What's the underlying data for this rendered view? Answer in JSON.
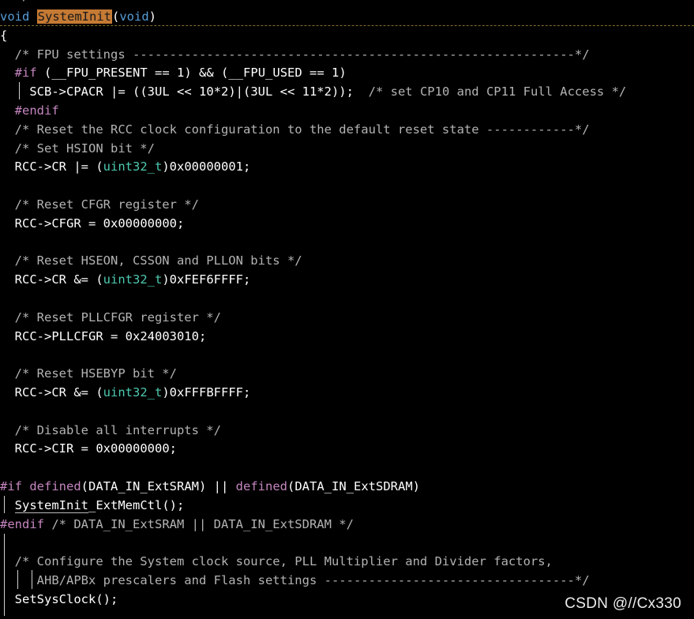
{
  "editor": {
    "top_fragment": "  */",
    "lines": [
      {
        "id": "l1",
        "parts": [
          [
            "kw",
            "void"
          ],
          [
            "sp",
            " "
          ],
          [
            "hl",
            "SystemInit"
          ],
          [
            "op",
            "("
          ],
          [
            "kw",
            "void"
          ],
          [
            "op",
            ")"
          ]
        ]
      },
      {
        "id": "l2",
        "parts": [
          [
            "op",
            "{"
          ]
        ]
      },
      {
        "id": "l3",
        "parts": [
          [
            "sp",
            "  "
          ],
          [
            "cm",
            "/* FPU settings ------------------------------------------------------------*/"
          ]
        ]
      },
      {
        "id": "l4",
        "parts": [
          [
            "sp",
            "  "
          ],
          [
            "pp",
            "#if"
          ],
          [
            "sp",
            " "
          ],
          [
            "op",
            "("
          ],
          [
            "mac",
            "__FPU_PRESENT"
          ],
          [
            "op",
            " == "
          ],
          [
            "num",
            "1"
          ],
          [
            "op",
            ")"
          ],
          [
            "op",
            " && "
          ],
          [
            "op",
            "("
          ],
          [
            "mac",
            "__FPU_USED"
          ],
          [
            "op",
            " == "
          ],
          [
            "num",
            "1"
          ],
          [
            "op",
            ")"
          ]
        ]
      },
      {
        "id": "l5",
        "parts": [
          [
            "sp",
            "    "
          ],
          [
            "id",
            "SCB->CPACR"
          ],
          [
            "op",
            " |= "
          ],
          [
            "op",
            "(("
          ],
          [
            "num",
            "3UL"
          ],
          [
            "op",
            " << "
          ],
          [
            "num",
            "10*2"
          ],
          [
            "op",
            ")|("
          ],
          [
            "num",
            "3UL"
          ],
          [
            "op",
            " << "
          ],
          [
            "num",
            "11*2"
          ],
          [
            "op",
            "));"
          ],
          [
            "sp",
            "  "
          ],
          [
            "cm",
            "/* set CP10 and CP11 Full Access */"
          ]
        ]
      },
      {
        "id": "l6",
        "parts": [
          [
            "sp",
            "  "
          ],
          [
            "pp",
            "#endif"
          ]
        ]
      },
      {
        "id": "l7",
        "parts": [
          [
            "sp",
            "  "
          ],
          [
            "cm",
            "/* Reset the RCC clock configuration to the default reset state ------------*/"
          ]
        ]
      },
      {
        "id": "l8",
        "parts": [
          [
            "sp",
            "  "
          ],
          [
            "cm",
            "/* Set HSION bit */"
          ]
        ]
      },
      {
        "id": "l9",
        "parts": [
          [
            "sp",
            "  "
          ],
          [
            "id",
            "RCC->CR"
          ],
          [
            "op",
            " |= "
          ],
          [
            "op",
            "("
          ],
          [
            "ty",
            "uint32_t"
          ],
          [
            "op",
            ")"
          ],
          [
            "num",
            "0x00000001"
          ],
          [
            "op",
            ";"
          ]
        ]
      },
      {
        "id": "l10",
        "parts": []
      },
      {
        "id": "l11",
        "parts": [
          [
            "sp",
            "  "
          ],
          [
            "cm",
            "/* Reset CFGR register */"
          ]
        ]
      },
      {
        "id": "l12",
        "parts": [
          [
            "sp",
            "  "
          ],
          [
            "id",
            "RCC->CFGR"
          ],
          [
            "op",
            " = "
          ],
          [
            "num",
            "0x00000000"
          ],
          [
            "op",
            ";"
          ]
        ]
      },
      {
        "id": "l13",
        "parts": []
      },
      {
        "id": "l14",
        "parts": [
          [
            "sp",
            "  "
          ],
          [
            "cm",
            "/* Reset HSEON, CSSON and PLLON bits */"
          ]
        ]
      },
      {
        "id": "l15",
        "parts": [
          [
            "sp",
            "  "
          ],
          [
            "id",
            "RCC->CR"
          ],
          [
            "op",
            " &= "
          ],
          [
            "op",
            "("
          ],
          [
            "ty",
            "uint32_t"
          ],
          [
            "op",
            ")"
          ],
          [
            "num",
            "0xFEF6FFFF"
          ],
          [
            "op",
            ";"
          ]
        ]
      },
      {
        "id": "l16",
        "parts": []
      },
      {
        "id": "l17",
        "parts": [
          [
            "sp",
            "  "
          ],
          [
            "cm",
            "/* Reset PLLCFGR register */"
          ]
        ]
      },
      {
        "id": "l18",
        "parts": [
          [
            "sp",
            "  "
          ],
          [
            "id",
            "RCC->PLLCFGR"
          ],
          [
            "op",
            " = "
          ],
          [
            "num",
            "0x24003010"
          ],
          [
            "op",
            ";"
          ]
        ]
      },
      {
        "id": "l19",
        "parts": []
      },
      {
        "id": "l20",
        "parts": [
          [
            "sp",
            "  "
          ],
          [
            "cm",
            "/* Reset HSEBYP bit */"
          ]
        ]
      },
      {
        "id": "l21",
        "parts": [
          [
            "sp",
            "  "
          ],
          [
            "id",
            "RCC->CR"
          ],
          [
            "op",
            " &= "
          ],
          [
            "op",
            "("
          ],
          [
            "ty",
            "uint32_t"
          ],
          [
            "op",
            ")"
          ],
          [
            "num",
            "0xFFFBFFFF"
          ],
          [
            "op",
            ";"
          ]
        ]
      },
      {
        "id": "l22",
        "parts": []
      },
      {
        "id": "l23",
        "parts": [
          [
            "sp",
            "  "
          ],
          [
            "cm",
            "/* Disable all interrupts */"
          ]
        ]
      },
      {
        "id": "l24",
        "parts": [
          [
            "sp",
            "  "
          ],
          [
            "id",
            "RCC->CIR"
          ],
          [
            "op",
            " = "
          ],
          [
            "num",
            "0x00000000"
          ],
          [
            "op",
            ";"
          ]
        ]
      },
      {
        "id": "l25",
        "parts": []
      },
      {
        "id": "l26",
        "parts": [
          [
            "pp",
            "#if"
          ],
          [
            "sp",
            " "
          ],
          [
            "pp",
            "defined"
          ],
          [
            "op",
            "("
          ],
          [
            "mac",
            "DATA_IN_ExtSRAM"
          ],
          [
            "op",
            ")"
          ],
          [
            "op",
            " || "
          ],
          [
            "pp",
            "defined"
          ],
          [
            "op",
            "("
          ],
          [
            "mac",
            "DATA_IN_ExtSDRAM"
          ],
          [
            "op",
            ")"
          ]
        ]
      },
      {
        "id": "l27",
        "parts": [
          [
            "sp",
            "  "
          ],
          [
            "und",
            "SystemInit"
          ],
          [
            "id",
            "_ExtMemCtl"
          ],
          [
            "op",
            "();"
          ]
        ]
      },
      {
        "id": "l28",
        "parts": [
          [
            "pp",
            "#endif"
          ],
          [
            "sp",
            " "
          ],
          [
            "cm",
            "/* DATA_IN_ExtSRAM || DATA_IN_ExtSDRAM */"
          ]
        ]
      },
      {
        "id": "l29",
        "parts": []
      },
      {
        "id": "l30",
        "parts": [
          [
            "sp",
            "  "
          ],
          [
            "cm",
            "/* Configure the System clock source, PLL Multiplier and Divider factors,"
          ]
        ]
      },
      {
        "id": "l31",
        "parts": [
          [
            "sp",
            "     "
          ],
          [
            "cm",
            "AHB/APBx prescalers and Flash settings ----------------------------------*/"
          ]
        ]
      },
      {
        "id": "l32",
        "parts": [
          [
            "sp",
            "  "
          ],
          [
            "id",
            "SetSysClock"
          ],
          [
            "op",
            "();"
          ]
        ]
      }
    ]
  },
  "colors": {
    "background": "#000000",
    "keyword": "#569cd6",
    "preprocessor": "#c586c0",
    "comment": "#b3b3b3",
    "type": "#4ec9b0",
    "highlight": "#c57a34"
  },
  "watermark": "CSDN @//Cx330"
}
